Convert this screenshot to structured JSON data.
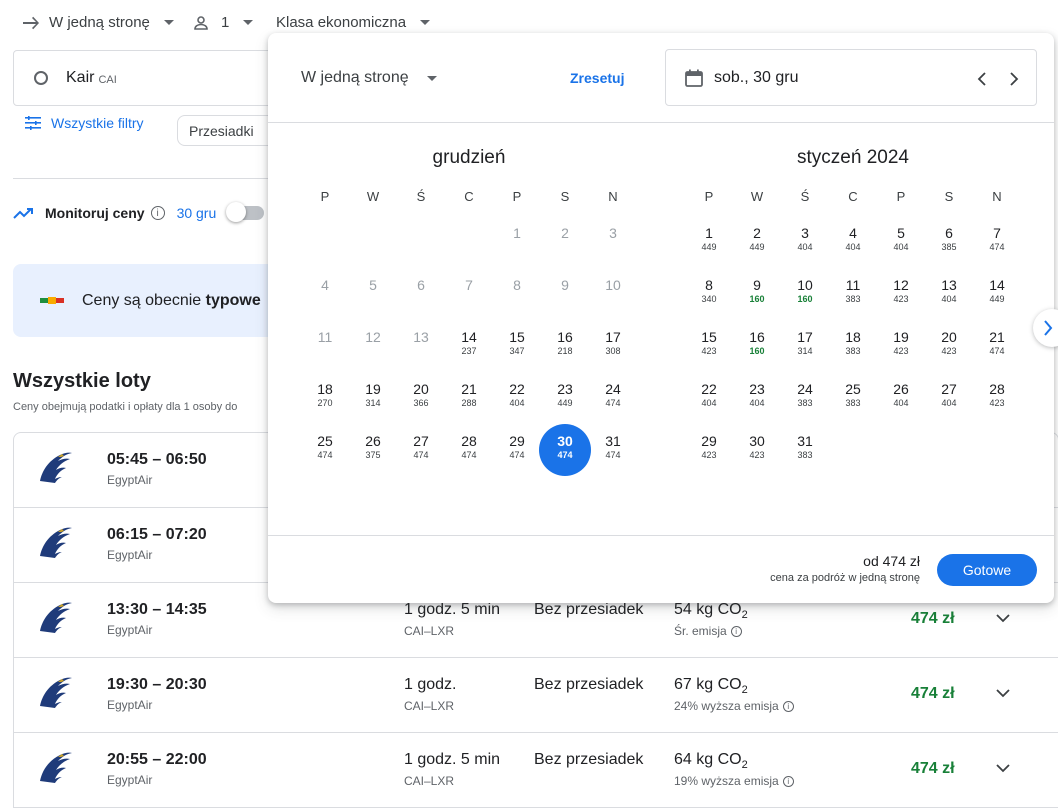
{
  "topbar": {
    "trip_type": "W jedną stronę",
    "passengers": "1",
    "cabin": "Klasa ekonomiczna"
  },
  "search": {
    "origin_city": "Kair",
    "origin_code": "CAI"
  },
  "filters": {
    "all_filters": "Wszystkie filtry",
    "stops_chip": "Przesiadki"
  },
  "monitor": {
    "label": "Monitoruj ceny",
    "date": "30 gru"
  },
  "insight": {
    "text_prefix": "Ceny są obecnie ",
    "text_bold": "typowe"
  },
  "results": {
    "title": "Wszystkie loty",
    "subtitle": "Ceny obejmują podatki i opłaty dla 1 osoby do",
    "flights": [
      {
        "times": "05:45 – 06:50",
        "airline": "EgyptAir",
        "duration": "",
        "route": "",
        "stops": "",
        "co2": "",
        "emission": "",
        "price": ""
      },
      {
        "times": "06:15 – 07:20",
        "airline": "EgyptAir",
        "duration": "",
        "route": "",
        "stops": "",
        "co2": "",
        "emission": "",
        "price": ""
      },
      {
        "times": "13:30 – 14:35",
        "airline": "EgyptAir",
        "duration": "1 godz. 5 min",
        "route": "CAI–LXR",
        "stops": "Bez przesiadek",
        "co2": "54 kg CO",
        "emission": "Śr. emisja",
        "price": "474 zł"
      },
      {
        "times": "19:30 – 20:30",
        "airline": "EgyptAir",
        "duration": "1 godz.",
        "route": "CAI–LXR",
        "stops": "Bez przesiadek",
        "co2": "67 kg CO",
        "emission": "24% wyższa emisja",
        "price": "474 zł"
      },
      {
        "times": "20:55 – 22:00",
        "airline": "EgyptAir",
        "duration": "1 godz. 5 min",
        "route": "CAI–LXR",
        "stops": "Bez przesiadek",
        "co2": "64 kg CO",
        "emission": "19% wyższa emisja",
        "price": "474 zł"
      }
    ]
  },
  "picker": {
    "trip_type": "W jedną stronę",
    "reset": "Zresetuj",
    "selected_date": "sob., 30 gru",
    "weekdays": [
      "P",
      "W",
      "Ś",
      "C",
      "P",
      "S",
      "N"
    ],
    "months": [
      {
        "name": "grudzień",
        "offset": 4,
        "days": [
          {
            "d": "1",
            "p": "",
            "muted": true
          },
          {
            "d": "2",
            "p": "",
            "muted": true
          },
          {
            "d": "3",
            "p": "",
            "muted": true
          },
          {
            "d": "4",
            "p": "",
            "muted": true
          },
          {
            "d": "5",
            "p": "",
            "muted": true
          },
          {
            "d": "6",
            "p": "",
            "muted": true
          },
          {
            "d": "7",
            "p": "",
            "muted": true
          },
          {
            "d": "8",
            "p": "",
            "muted": true
          },
          {
            "d": "9",
            "p": "",
            "muted": true
          },
          {
            "d": "10",
            "p": "",
            "muted": true
          },
          {
            "d": "11",
            "p": "",
            "muted": true
          },
          {
            "d": "12",
            "p": "",
            "muted": true
          },
          {
            "d": "13",
            "p": "",
            "muted": true
          },
          {
            "d": "14",
            "p": "237"
          },
          {
            "d": "15",
            "p": "347"
          },
          {
            "d": "16",
            "p": "218"
          },
          {
            "d": "17",
            "p": "308"
          },
          {
            "d": "18",
            "p": "270"
          },
          {
            "d": "19",
            "p": "314"
          },
          {
            "d": "20",
            "p": "366"
          },
          {
            "d": "21",
            "p": "288"
          },
          {
            "d": "22",
            "p": "404"
          },
          {
            "d": "23",
            "p": "449"
          },
          {
            "d": "24",
            "p": "474"
          },
          {
            "d": "25",
            "p": "474"
          },
          {
            "d": "26",
            "p": "375"
          },
          {
            "d": "27",
            "p": "474"
          },
          {
            "d": "28",
            "p": "474"
          },
          {
            "d": "29",
            "p": "474"
          },
          {
            "d": "30",
            "p": "474",
            "selected": true
          },
          {
            "d": "31",
            "p": "474"
          }
        ]
      },
      {
        "name": "styczeń 2024",
        "offset": 0,
        "days": [
          {
            "d": "1",
            "p": "449"
          },
          {
            "d": "2",
            "p": "449"
          },
          {
            "d": "3",
            "p": "404"
          },
          {
            "d": "4",
            "p": "404"
          },
          {
            "d": "5",
            "p": "404"
          },
          {
            "d": "6",
            "p": "385"
          },
          {
            "d": "7",
            "p": "474"
          },
          {
            "d": "8",
            "p": "340"
          },
          {
            "d": "9",
            "p": "160",
            "low": true
          },
          {
            "d": "10",
            "p": "160",
            "low": true
          },
          {
            "d": "11",
            "p": "383"
          },
          {
            "d": "12",
            "p": "423"
          },
          {
            "d": "13",
            "p": "404"
          },
          {
            "d": "14",
            "p": "449"
          },
          {
            "d": "15",
            "p": "423"
          },
          {
            "d": "16",
            "p": "160",
            "low": true
          },
          {
            "d": "17",
            "p": "314"
          },
          {
            "d": "18",
            "p": "383"
          },
          {
            "d": "19",
            "p": "423"
          },
          {
            "d": "20",
            "p": "423"
          },
          {
            "d": "21",
            "p": "474"
          },
          {
            "d": "22",
            "p": "404"
          },
          {
            "d": "23",
            "p": "404"
          },
          {
            "d": "24",
            "p": "383"
          },
          {
            "d": "25",
            "p": "383"
          },
          {
            "d": "26",
            "p": "404"
          },
          {
            "d": "27",
            "p": "404"
          },
          {
            "d": "28",
            "p": "423"
          },
          {
            "d": "29",
            "p": "423"
          },
          {
            "d": "30",
            "p": "423"
          },
          {
            "d": "31",
            "p": "383"
          }
        ]
      }
    ],
    "from_price": "od 474 zł",
    "price_note": "cena za podróż w jedną stronę",
    "done": "Gotowe"
  },
  "colors": {
    "accent": "#1a73e8",
    "price_green": "#188038"
  }
}
